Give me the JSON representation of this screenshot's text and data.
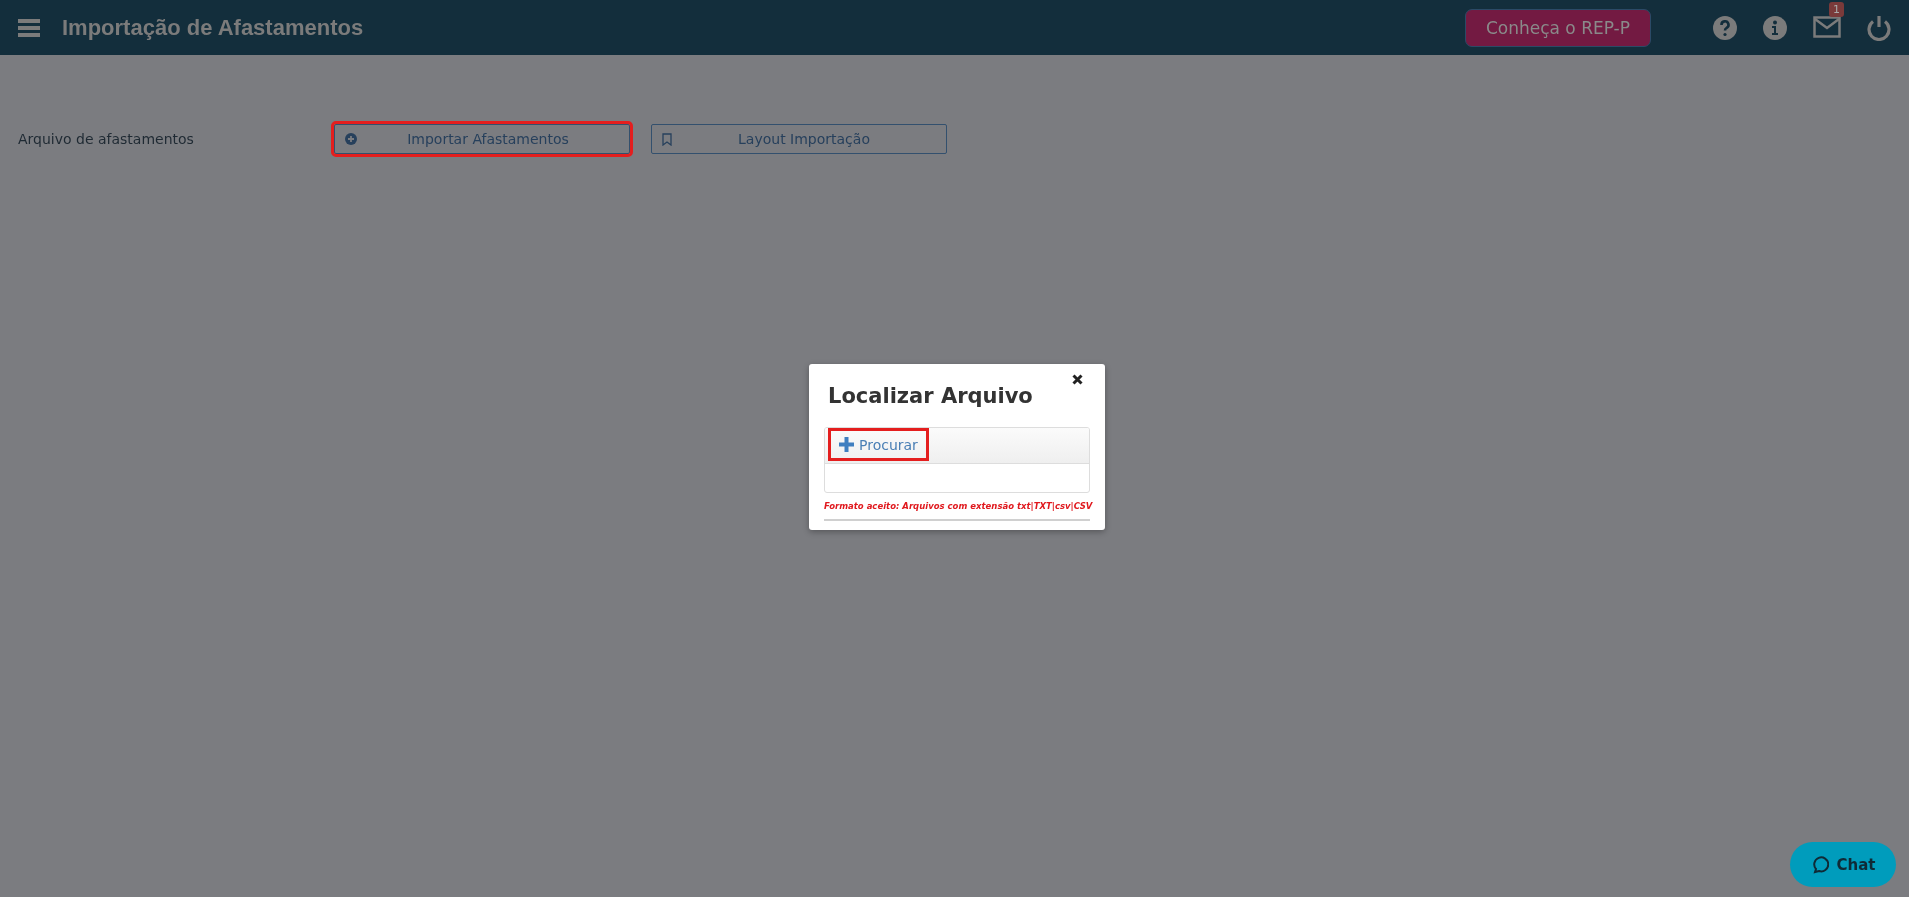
{
  "header": {
    "title": "Importação de Afastamentos",
    "promo_button": "Conheça o REP-P",
    "notification_count": "1"
  },
  "form": {
    "label": "Arquivo de afastamentos",
    "buttons": [
      {
        "label": "Importar Afastamentos",
        "kind": "import",
        "highlighted": true
      },
      {
        "label": "Layout Importação",
        "kind": "layout",
        "highlighted": false
      }
    ]
  },
  "dialog": {
    "title": "Localizar Arquivo",
    "browse_button": {
      "label": "Procurar",
      "highlighted": true
    },
    "hint": "Formato aceito: Arquivos com extensão txt|TXT|csv|CSV"
  },
  "chat": {
    "label": "Chat"
  }
}
